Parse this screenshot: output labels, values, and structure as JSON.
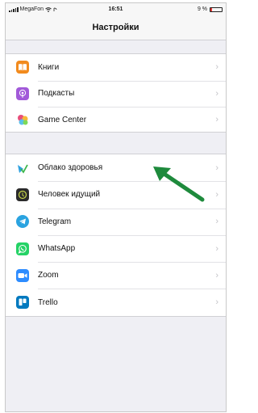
{
  "status_bar": {
    "carrier": "MegaFon",
    "time": "16:51",
    "battery_text": "9 %",
    "battery_level": 0.09,
    "battery_color": "#e53935"
  },
  "nav": {
    "title": "Настройки"
  },
  "group1": {
    "items": [
      {
        "label": "Книги",
        "icon": "books-icon",
        "color": "#f28b1e"
      },
      {
        "label": "Подкасты",
        "icon": "podcasts-icon",
        "color": "#a25ad9"
      },
      {
        "label": "Game Center",
        "icon": "game-center-icon",
        "color": "#e84d7a"
      }
    ]
  },
  "group2": {
    "items": [
      {
        "label": "Облако здоровья",
        "icon": "health-cloud-icon",
        "color": "#2fa1e0"
      },
      {
        "label": "Человек идущий",
        "icon": "walking-man-icon",
        "color": "#2b2b2b"
      },
      {
        "label": "Telegram",
        "icon": "telegram-icon",
        "color": "#2aa3e0"
      },
      {
        "label": "WhatsApp",
        "icon": "whatsapp-icon",
        "color": "#25d366"
      },
      {
        "label": "Zoom",
        "icon": "zoom-icon",
        "color": "#2d8cff"
      },
      {
        "label": "Trello",
        "icon": "trello-icon",
        "color": "#0079bf"
      }
    ]
  },
  "annotation": {
    "arrow_color": "#1e8a3c",
    "points_to": "Облако здоровья"
  }
}
